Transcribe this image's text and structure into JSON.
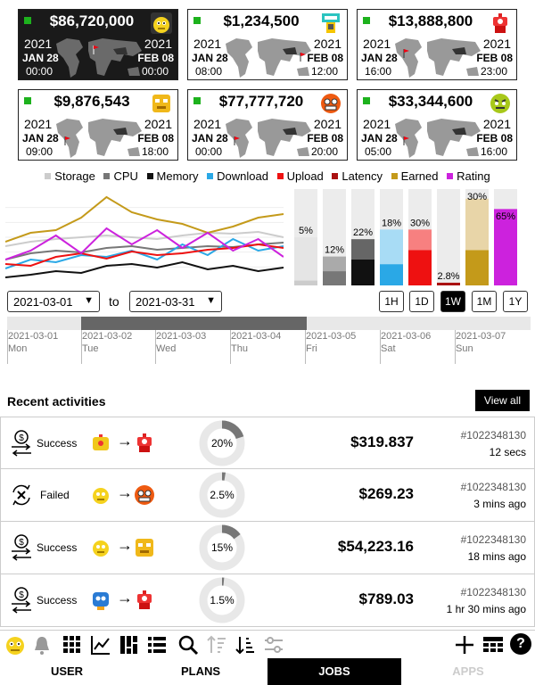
{
  "cards": [
    {
      "amount": "$86,720,000",
      "y1": "2021",
      "d1": "JAN 28",
      "t1": "00:00",
      "y2": "2021",
      "d2": "FEB 08",
      "t2": "00:00",
      "avatar": "yellow-robot",
      "dark": true
    },
    {
      "amount": "$1,234,500",
      "y1": "2021",
      "d1": "JAN 28",
      "t1": "08:00",
      "y2": "2021",
      "d2": "FEB 08",
      "t2": "12:00",
      "avatar": "teal-robot"
    },
    {
      "amount": "$13,888,800",
      "y1": "2021",
      "d1": "JAN 28",
      "t1": "16:00",
      "y2": "2021",
      "d2": "FEB 08",
      "t2": "23:00",
      "avatar": "red-robot"
    },
    {
      "amount": "$9,876,543",
      "y1": "2021",
      "d1": "JAN 28",
      "t1": "09:00",
      "y2": "2021",
      "d2": "FEB 08",
      "t2": "18:00",
      "avatar": "gold-robot"
    },
    {
      "amount": "$77,777,720",
      "y1": "2021",
      "d1": "JAN 28",
      "t1": "00:00",
      "y2": "2021",
      "d2": "FEB 08",
      "t2": "20:00",
      "avatar": "orange-robot"
    },
    {
      "amount": "$33,344,600",
      "y1": "2021",
      "d1": "JAN 28",
      "t1": "05:00",
      "y2": "2021",
      "d2": "FEB 08",
      "t2": "16:00",
      "avatar": "lime-robot"
    }
  ],
  "legend": [
    {
      "label": "Storage",
      "color": "#cccccc"
    },
    {
      "label": "CPU",
      "color": "#777777"
    },
    {
      "label": "Memory",
      "color": "#111111"
    },
    {
      "label": "Download",
      "color": "#2aa8e6"
    },
    {
      "label": "Upload",
      "color": "#ee1111"
    },
    {
      "label": "Latency",
      "color": "#aa1111"
    },
    {
      "label": "Earned",
      "color": "#c49a1a"
    },
    {
      "label": "Rating",
      "color": "#cc22dd"
    }
  ],
  "chart_data": {
    "type": "line",
    "series": [
      {
        "name": "Storage",
        "color": "#cccccc",
        "values": [
          40,
          45,
          48,
          50,
          52,
          50,
          48,
          52,
          55,
          54,
          56,
          50
        ]
      },
      {
        "name": "CPU",
        "color": "#777777",
        "values": [
          25,
          32,
          35,
          33,
          38,
          40,
          36,
          38,
          40,
          39,
          42,
          44
        ]
      },
      {
        "name": "Memory",
        "color": "#111111",
        "values": [
          5,
          8,
          12,
          10,
          18,
          20,
          16,
          22,
          14,
          18,
          12,
          16
        ]
      },
      {
        "name": "Download",
        "color": "#2aa8e6",
        "values": [
          15,
          25,
          22,
          30,
          28,
          35,
          25,
          42,
          30,
          48,
          35,
          40
        ]
      },
      {
        "name": "Upload",
        "color": "#ee1111",
        "values": [
          20,
          18,
          28,
          32,
          26,
          34,
          30,
          32,
          36,
          38,
          42,
          38
        ]
      },
      {
        "name": "Earned",
        "color": "#c49a1a",
        "values": [
          45,
          55,
          58,
          72,
          95,
          78,
          70,
          65,
          55,
          62,
          72,
          76
        ]
      },
      {
        "name": "Rating",
        "color": "#cc22dd",
        "values": [
          25,
          35,
          52,
          32,
          60,
          42,
          58,
          38,
          55,
          35,
          48,
          28
        ]
      }
    ],
    "bars": [
      {
        "label": "5%",
        "value": 5,
        "color": "#cccccc",
        "ghost": "#e5e5e5",
        "ghost_value": 50
      },
      {
        "label": "12%",
        "value": 12,
        "color": "#777777",
        "ghost": "#aaaaaa",
        "ghost_value": 30
      },
      {
        "label": "22%",
        "value": 22,
        "color": "#111111",
        "ghost": "#666666",
        "ghost_value": 48
      },
      {
        "label": "18%",
        "value": 18,
        "color": "#2aa8e6",
        "ghost": "#a8dcf5",
        "ghost_value": 58
      },
      {
        "label": "30%",
        "value": 30,
        "color": "#ee1111",
        "ghost": "#f78080",
        "ghost_value": 58
      },
      {
        "label": "2.8%",
        "value": 2.8,
        "color": "#aa1111",
        "ghost": "#cc6666",
        "ghost_value": 2.8
      },
      {
        "label": "30%",
        "value": 30,
        "color": "#c49a1a",
        "ghost": "#e8d5a8",
        "ghost_value": 90
      },
      {
        "label": "65%",
        "value": 65,
        "color": "#cc22dd",
        "ghost": "#e5e5e5",
        "ghost_value": 65
      }
    ],
    "ylim": [
      0,
      100
    ]
  },
  "range": {
    "from": "2021-03-01",
    "to_label": "to",
    "to": "2021-03-31",
    "zooms": [
      "1H",
      "1D",
      "1W",
      "1M",
      "1Y"
    ],
    "active_zoom": "1W"
  },
  "timeline_ticks": [
    {
      "date": "2021-03-01",
      "day": "Mon"
    },
    {
      "date": "2021-03-02",
      "day": "Tue"
    },
    {
      "date": "2021-03-03",
      "day": "Wed"
    },
    {
      "date": "2021-03-04",
      "day": "Thu"
    },
    {
      "date": "2021-03-05",
      "day": "Fri"
    },
    {
      "date": "2021-03-06",
      "day": "Sat"
    },
    {
      "date": "2021-03-07",
      "day": "Sun"
    }
  ],
  "recent": {
    "title": "Recent activities",
    "view_all": "View all"
  },
  "activities": [
    {
      "status": "Success",
      "icon": "dollar-transfer-icon",
      "from": "yellow-robot",
      "to": "red-robot",
      "percent": 20,
      "percent_label": "20%",
      "amount": "$319.837",
      "id": "#1022348130",
      "time": "12 secs"
    },
    {
      "status": "Failed",
      "icon": "failed-transfer-icon",
      "from": "yellow-robot",
      "to": "orange-robot",
      "percent": 2.5,
      "percent_label": "2.5%",
      "amount": "$269.23",
      "id": "#1022348130",
      "time": "3 mins ago"
    },
    {
      "status": "Success",
      "icon": "dollar-transfer-icon",
      "from": "yellow-robot",
      "to": "gold-robot",
      "percent": 15,
      "percent_label": "15%",
      "amount": "$54,223.16",
      "id": "#1022348130",
      "time": "18 mins ago"
    },
    {
      "status": "Success",
      "icon": "dollar-transfer-icon",
      "from": "blue-robot",
      "to": "red-robot",
      "percent": 1.5,
      "percent_label": "1.5%",
      "amount": "$789.03",
      "id": "#1022348130",
      "time": "1 hr 30 mins ago"
    }
  ],
  "tabs": [
    {
      "label": "USER",
      "state": "normal"
    },
    {
      "label": "PLANS",
      "state": "normal"
    },
    {
      "label": "JOBS",
      "state": "active"
    },
    {
      "label": "APPS",
      "state": "disabled"
    }
  ],
  "toolbar": {
    "help": "?"
  }
}
